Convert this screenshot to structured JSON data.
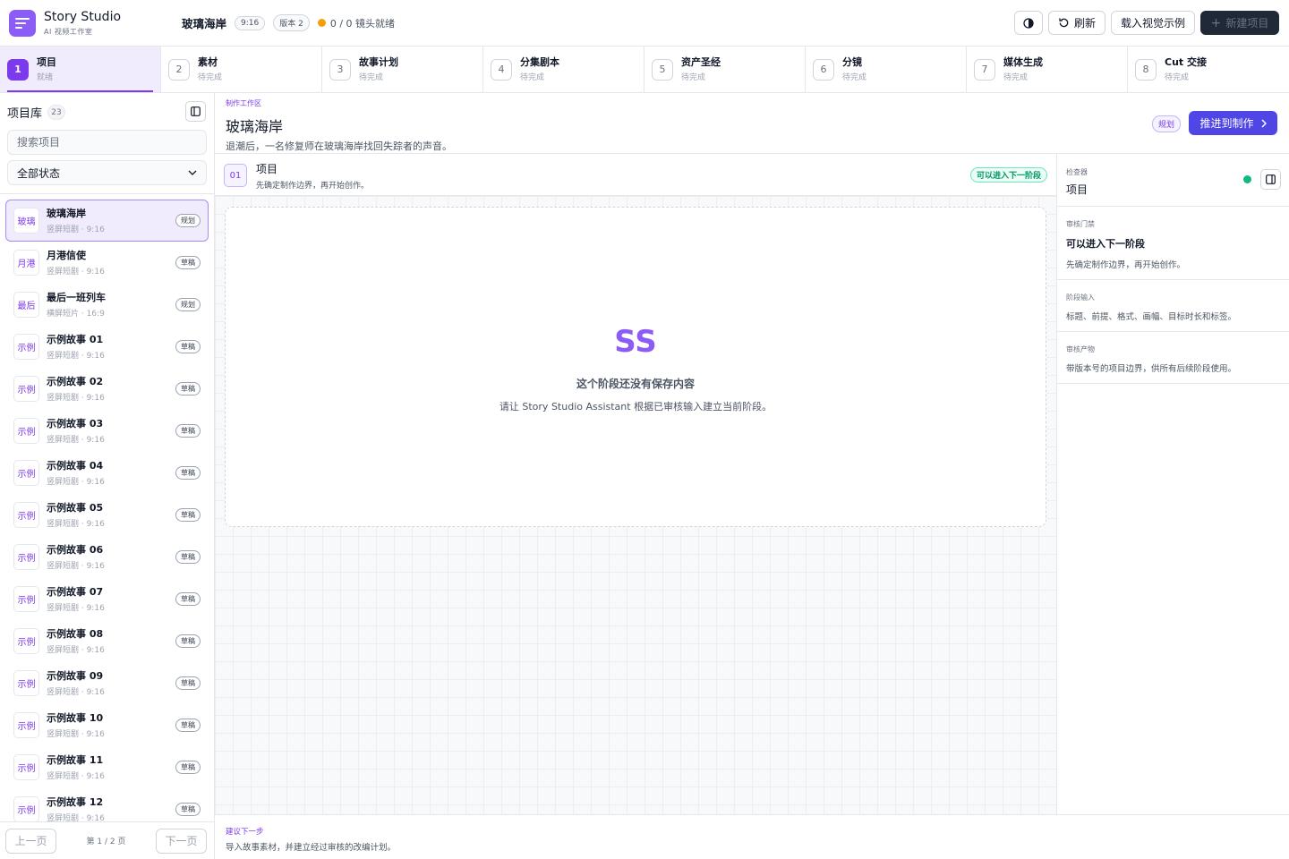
{
  "app": {
    "title": "Story Studio",
    "subtitle": "AI 视频工作室"
  },
  "header": {
    "project_name": "玻璃海岸",
    "aspect": "9:16",
    "version": "版本 2",
    "ready_text": "0 / 0 镜头就绪",
    "refresh_label": "刷新",
    "load_example_label": "载入视觉示例",
    "new_project_label": "新建项目"
  },
  "steps": [
    {
      "num": "1",
      "label": "项目",
      "status": "就绪"
    },
    {
      "num": "2",
      "label": "素材",
      "status": "待完成"
    },
    {
      "num": "3",
      "label": "故事计划",
      "status": "待完成"
    },
    {
      "num": "4",
      "label": "分集剧本",
      "status": "待完成"
    },
    {
      "num": "5",
      "label": "资产圣经",
      "status": "待完成"
    },
    {
      "num": "6",
      "label": "分镜",
      "status": "待完成"
    },
    {
      "num": "7",
      "label": "媒体生成",
      "status": "待完成"
    },
    {
      "num": "8",
      "label": "Cut 交接",
      "status": "待完成"
    }
  ],
  "sidebar": {
    "title": "项目库",
    "count": "23",
    "search_placeholder": "搜索项目",
    "filter_value": "全部状态",
    "projects": [
      {
        "avatar": "玻璃",
        "name": "玻璃海岸",
        "meta": "竖屏短剧 · 9:16",
        "badge": "规划"
      },
      {
        "avatar": "月港",
        "name": "月港信使",
        "meta": "竖屏短剧 · 9:16",
        "badge": "草稿"
      },
      {
        "avatar": "最后",
        "name": "最后一班列车",
        "meta": "横屏短片 · 16:9",
        "badge": "规划"
      },
      {
        "avatar": "示例",
        "name": "示例故事 01",
        "meta": "竖屏短剧 · 9:16",
        "badge": "草稿"
      },
      {
        "avatar": "示例",
        "name": "示例故事 02",
        "meta": "竖屏短剧 · 9:16",
        "badge": "草稿"
      },
      {
        "avatar": "示例",
        "name": "示例故事 03",
        "meta": "竖屏短剧 · 9:16",
        "badge": "草稿"
      },
      {
        "avatar": "示例",
        "name": "示例故事 04",
        "meta": "竖屏短剧 · 9:16",
        "badge": "草稿"
      },
      {
        "avatar": "示例",
        "name": "示例故事 05",
        "meta": "竖屏短剧 · 9:16",
        "badge": "草稿"
      },
      {
        "avatar": "示例",
        "name": "示例故事 06",
        "meta": "竖屏短剧 · 9:16",
        "badge": "草稿"
      },
      {
        "avatar": "示例",
        "name": "示例故事 07",
        "meta": "竖屏短剧 · 9:16",
        "badge": "草稿"
      },
      {
        "avatar": "示例",
        "name": "示例故事 08",
        "meta": "竖屏短剧 · 9:16",
        "badge": "草稿"
      },
      {
        "avatar": "示例",
        "name": "示例故事 09",
        "meta": "竖屏短剧 · 9:16",
        "badge": "草稿"
      },
      {
        "avatar": "示例",
        "name": "示例故事 10",
        "meta": "竖屏短剧 · 9:16",
        "badge": "草稿"
      },
      {
        "avatar": "示例",
        "name": "示例故事 11",
        "meta": "竖屏短剧 · 9:16",
        "badge": "草稿"
      },
      {
        "avatar": "示例",
        "name": "示例故事 12",
        "meta": "竖屏短剧 · 9:16",
        "badge": "草稿"
      }
    ],
    "prev_label": "上一页",
    "page_info": "第 1 / 2 页",
    "next_label": "下一页"
  },
  "workspace": {
    "label": "制作工作区",
    "title": "玻璃海岸",
    "description": "退潮后，一名修复师在玻璃海岸找回失踪者的声音。",
    "badge": "规划",
    "advance_label": "推进到制作"
  },
  "stage": {
    "num": "01",
    "title": "项目",
    "description": "先确定制作边界，再开始创作。",
    "status": "可以进入下一阶段"
  },
  "empty": {
    "mark": "SS",
    "title": "这个阶段还没有保存内容",
    "description": "请让 Story Studio Assistant 根据已审核输入建立当前阶段。"
  },
  "inspector": {
    "label": "检查器",
    "title": "项目",
    "gate_label": "审核门禁",
    "gate_value": "可以进入下一阶段",
    "gate_text": "先确定制作边界，再开始创作。",
    "input_label": "阶段输入",
    "input_text": "标题、前提、格式、画幅、目标时长和标签。",
    "output_label": "审核产物",
    "output_text": "带版本号的项目边界，供所有后续阶段使用。"
  },
  "footer": {
    "label": "建议下一步",
    "text": "导入故事素材，并建立经过审核的改编计划。"
  },
  "colors": {
    "accent": "#7c3aed",
    "primary_button": "#4f46e5",
    "success": "#10b981",
    "warning": "#f59e0b"
  }
}
